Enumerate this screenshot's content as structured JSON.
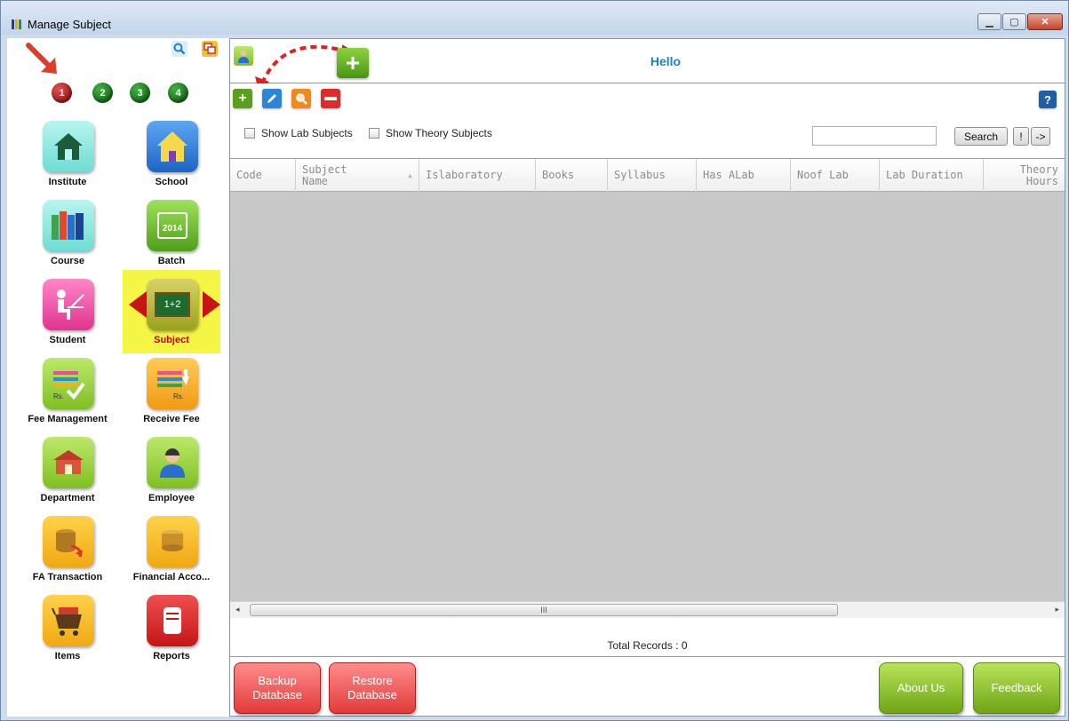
{
  "window": {
    "title": "Manage Subject",
    "controls": [
      "minimize",
      "maximize",
      "close"
    ]
  },
  "sidebar": {
    "tools": [
      {
        "icon": "search-icon",
        "color": "#2a8fd8"
      },
      {
        "icon": "windows-icon",
        "color": "#d23b2b"
      }
    ],
    "steps": [
      "1",
      "2",
      "3",
      "4"
    ],
    "items": [
      {
        "label": "Institute",
        "icon": "institute-house-icon"
      },
      {
        "label": "School",
        "icon": "school-house-icon"
      },
      {
        "label": "Course",
        "icon": "books-icon"
      },
      {
        "label": "Batch",
        "icon": "calendar-icon",
        "icon_text": "2014"
      },
      {
        "label": "Student",
        "icon": "student-desk-icon"
      },
      {
        "label": "Subject",
        "icon": "chalkboard-icon",
        "icon_text": "1+2",
        "active": true
      },
      {
        "label": "Fee Management",
        "icon": "fee-list-check-icon",
        "icon_text": "Rs."
      },
      {
        "label": "Receive Fee",
        "icon": "fee-list-download-icon",
        "icon_text": "Rs."
      },
      {
        "label": "Department",
        "icon": "department-building-icon"
      },
      {
        "label": "Employee",
        "icon": "employee-person-icon"
      },
      {
        "label": "FA Transaction",
        "icon": "coins-transaction-icon"
      },
      {
        "label": "Financial Acco...",
        "icon": "coins-icon"
      },
      {
        "label": "Items",
        "icon": "shopping-cart-icon"
      },
      {
        "label": "Reports",
        "icon": "scroll-report-icon"
      }
    ]
  },
  "header": {
    "greeting": "Hello",
    "user_icon": "user-icon",
    "add_icon": "add-icon"
  },
  "toolbar": {
    "buttons": [
      {
        "icon": "add-icon",
        "color": "#5ba01c"
      },
      {
        "icon": "edit-pencil-icon",
        "color": "#2b86d6"
      },
      {
        "icon": "search-magnifier-icon",
        "color": "#f08a1c"
      },
      {
        "icon": "delete-minus-icon",
        "color": "#e02b2b"
      }
    ],
    "help_label": "?"
  },
  "filters": {
    "show_lab": "Show Lab Subjects",
    "show_theory": "Show Theory Subjects",
    "search_value": "",
    "search_label": "Search",
    "bang_label": "!",
    "arrow_label": "->"
  },
  "grid": {
    "columns": [
      "Code",
      "Subject Name",
      "Islaboratory",
      "Books",
      "Syllabus",
      "Has ALab",
      "Noof Lab",
      "Lab Duration",
      "Theory Hours"
    ],
    "rows": [],
    "scroll_grip": "III"
  },
  "status": {
    "total_records": "Total Records : 0"
  },
  "footer": {
    "backup": "Backup Database",
    "restore": "Restore Database",
    "about": "About Us",
    "feedback": "Feedback"
  }
}
